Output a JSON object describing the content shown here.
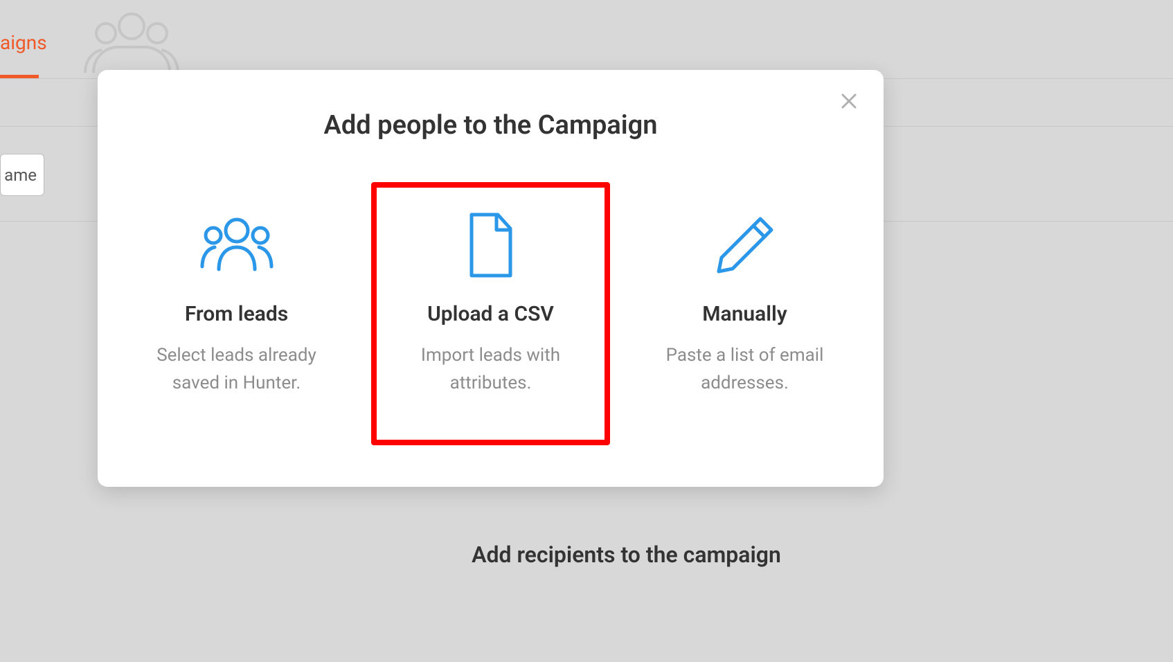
{
  "background": {
    "tab_label_fragment": "aigns",
    "name_box_fragment": "ame",
    "bottom_title": "Add recipients to the campaign"
  },
  "modal": {
    "title": "Add people to the Campaign",
    "close_icon_name": "close-icon",
    "options": [
      {
        "id": "from-leads",
        "title": "From leads",
        "description": "Select leads already saved in Hunter.",
        "icon": "people-icon",
        "highlighted": false
      },
      {
        "id": "upload-csv",
        "title": "Upload a CSV",
        "description": "Import leads with attributes.",
        "icon": "file-icon",
        "highlighted": true
      },
      {
        "id": "manually",
        "title": "Manually",
        "description": "Paste a list of email addresses.",
        "icon": "pencil-icon",
        "highlighted": false
      }
    ]
  },
  "colors": {
    "accent": "#f05a28",
    "icon_blue": "#2a97e8",
    "highlight_border": "#ff0000"
  }
}
